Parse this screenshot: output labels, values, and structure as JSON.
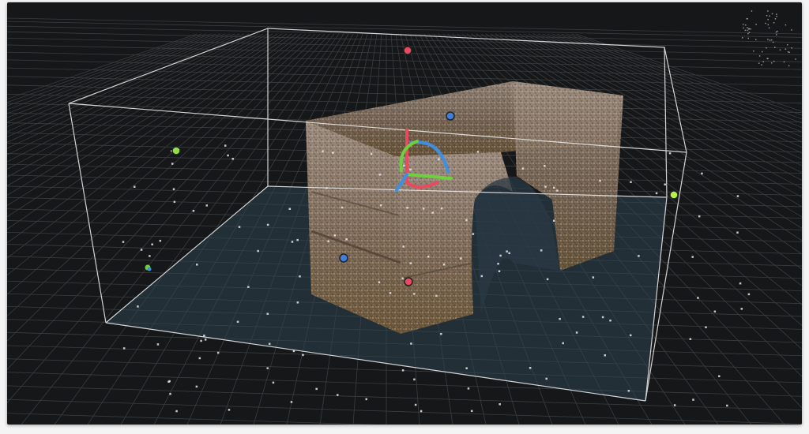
{
  "viewport": {
    "background": "#161718",
    "grid_color": "#3a3d40",
    "floor_tint": "#2e4452",
    "bbox_color": "#e8e8e8"
  },
  "scene": {
    "object": "point-cloud-arch",
    "handles": [
      {
        "name": "top-face-handle",
        "color": "#e84a5f",
        "axis": "y"
      },
      {
        "name": "bottom-face-handle",
        "color": "#e84a5f",
        "axis": "y"
      },
      {
        "name": "left-face-handle",
        "color": "#8fe04a",
        "axis": "x"
      },
      {
        "name": "right-face-handle",
        "color": "#b9f04a",
        "axis": "x"
      },
      {
        "name": "back-face-handle",
        "color": "#3f7fd9",
        "axis": "z"
      },
      {
        "name": "front-face-handle",
        "color": "#3f7fd9",
        "axis": "z"
      }
    ],
    "gizmo": {
      "name": "rotation-gizmo",
      "colors": {
        "x": "#e84a5f",
        "y": "#6fd03f",
        "z": "#3f8fe0"
      }
    }
  }
}
